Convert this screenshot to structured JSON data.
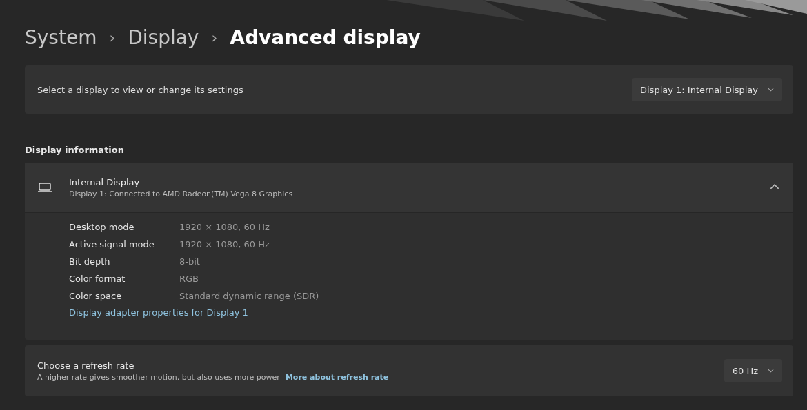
{
  "breadcrumb": [
    {
      "label": "System",
      "current": false
    },
    {
      "label": "›",
      "kind": "separator"
    },
    {
      "label": "Display",
      "current": false
    },
    {
      "label": "›",
      "kind": "separator"
    },
    {
      "label": "Advanced display",
      "current": true
    }
  ],
  "display_select": {
    "label": "Select a display to view or change its settings",
    "value": "Display 1: Internal Display"
  },
  "section_title": "Display information",
  "display_info": {
    "title": "Internal Display",
    "subtitle": "Display 1: Connected to AMD Radeon(TM) Vega 8 Graphics",
    "expanded": true,
    "rows": [
      {
        "label": "Desktop mode",
        "value": "1920 × 1080, 60 Hz"
      },
      {
        "label": "Active signal mode",
        "value": "1920 × 1080, 60 Hz"
      },
      {
        "label": "Bit depth",
        "value": "8-bit"
      },
      {
        "label": "Color format",
        "value": "RGB"
      },
      {
        "label": "Color space",
        "value": "Standard dynamic range (SDR)"
      }
    ],
    "link": "Display adapter properties for Display 1"
  },
  "refresh_rate": {
    "title": "Choose a refresh rate",
    "description": "A higher rate gives smoother motion, but also uses more power",
    "link": "More about refresh rate",
    "value": "60 Hz"
  }
}
